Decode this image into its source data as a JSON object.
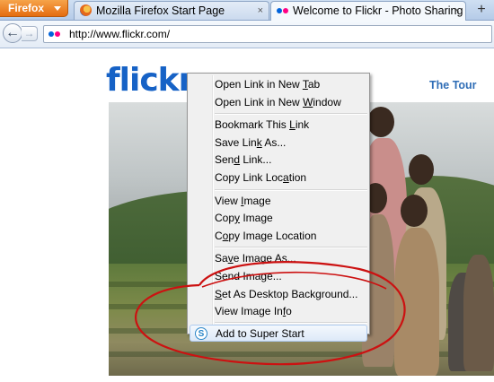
{
  "browser": {
    "menu_button": "Firefox",
    "tabs": [
      {
        "title": "Mozilla Firefox Start Page",
        "close": "×"
      },
      {
        "title": "Welcome to Flickr - Photo Sharing",
        "close": "×"
      }
    ],
    "new_tab": "+",
    "url": "http://www.flickr.com/",
    "back": "←",
    "forward": "→"
  },
  "page": {
    "logo": {
      "part1": "flickr",
      "part2": ""
    },
    "tour_link": "The Tour"
  },
  "context_menu": {
    "groups": [
      [
        {
          "before": "Open Link in New ",
          "key": "T",
          "after": "ab"
        },
        {
          "before": "Open Link in New ",
          "key": "W",
          "after": "indow"
        }
      ],
      [
        {
          "before": "Bookmark This ",
          "key": "L",
          "after": "ink"
        },
        {
          "before": "Save Lin",
          "key": "k",
          "after": " As..."
        },
        {
          "before": "Sen",
          "key": "d",
          "after": " Link..."
        },
        {
          "before": "Copy Link Loc",
          "key": "a",
          "after": "tion"
        }
      ],
      [
        {
          "before": "View ",
          "key": "I",
          "after": "mage"
        },
        {
          "before": "Cop",
          "key": "y",
          "after": " Image"
        },
        {
          "before": "C",
          "key": "o",
          "after": "py Image Location"
        }
      ],
      [
        {
          "before": "Sa",
          "key": "v",
          "after": "e Image As..."
        },
        {
          "before": "Send Ima",
          "key": "g",
          "after": "e..."
        },
        {
          "before": "",
          "key": "S",
          "after": "et As Desktop Background..."
        },
        {
          "before": "View Image In",
          "key": "f",
          "after": "o"
        }
      ]
    ],
    "super_start": {
      "label": "Add to Super Start",
      "icon": "super-start-icon",
      "icon_glyph": "S"
    }
  },
  "colors": {
    "flickr_blue": "#0063dc",
    "flickr_pink": "#ff0084",
    "annotation_red": "#cc1111"
  }
}
